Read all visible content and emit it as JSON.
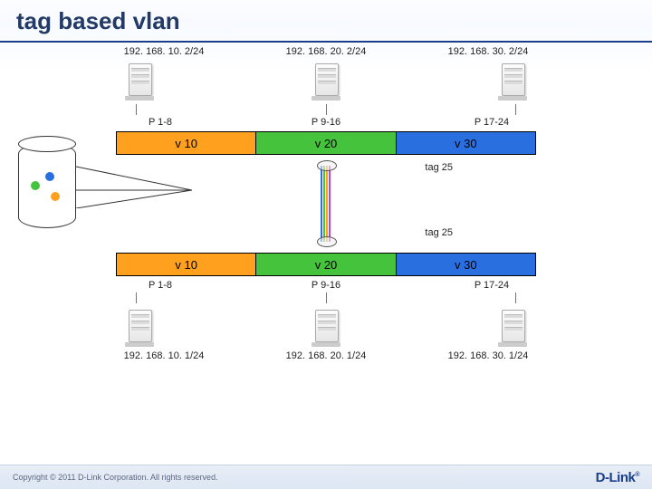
{
  "header": {
    "title": "tag based vlan"
  },
  "top": {
    "ips": [
      "192. 168. 10. 2/24",
      "192. 168. 20. 2/24",
      "192. 168. 30. 2/24"
    ],
    "ports": [
      "P 1-8",
      "P 9-16",
      "P 17-24"
    ]
  },
  "bottom": {
    "ports": [
      "P 1-8",
      "P 9-16",
      "P 17-24"
    ],
    "ips": [
      "192. 168. 10. 1/24",
      "192. 168. 20. 1/24",
      "192. 168. 30. 1/24"
    ]
  },
  "vlans": {
    "v10": "v 10",
    "v20": "v 20",
    "v30": "v 30"
  },
  "trunk": {
    "tag_upper": "tag 25",
    "tag_lower": "tag 25"
  },
  "colors": {
    "v10": "#ffa11f",
    "v20": "#45c33d",
    "v30": "#2a6fe0",
    "accent": "#1a3e8a"
  },
  "footer": {
    "copyright": "Copyright © 2011 D-Link Corporation. All rights reserved.",
    "brand": "D-Link"
  },
  "chart_data": {
    "type": "table",
    "title": "tag based vlan",
    "description": "Two 24-port switches connected by a tagged trunk on port 25. Each switch has three port-based VLANs (v10, v20, v30) mapped to port ranges 1-8, 9-16, 17-24 with one host per VLAN.",
    "switches": [
      {
        "role": "top",
        "vlans": [
          {
            "vlan": "v10",
            "ports": "P1-8",
            "host_ip": "192.168.10.2/24"
          },
          {
            "vlan": "v20",
            "ports": "P9-16",
            "host_ip": "192.168.20.2/24"
          },
          {
            "vlan": "v30",
            "ports": "P17-24",
            "host_ip": "192.168.30.2/24"
          }
        ]
      },
      {
        "role": "bottom",
        "vlans": [
          {
            "vlan": "v10",
            "ports": "P1-8",
            "host_ip": "192.168.10.1/24"
          },
          {
            "vlan": "v20",
            "ports": "P9-16",
            "host_ip": "192.168.20.1/24"
          },
          {
            "vlan": "v30",
            "ports": "P17-24",
            "host_ip": "192.168.30.1/24"
          }
        ]
      }
    ],
    "trunk": {
      "port": 25,
      "type": "tagged",
      "carries": [
        "v10",
        "v20",
        "v30"
      ]
    }
  }
}
